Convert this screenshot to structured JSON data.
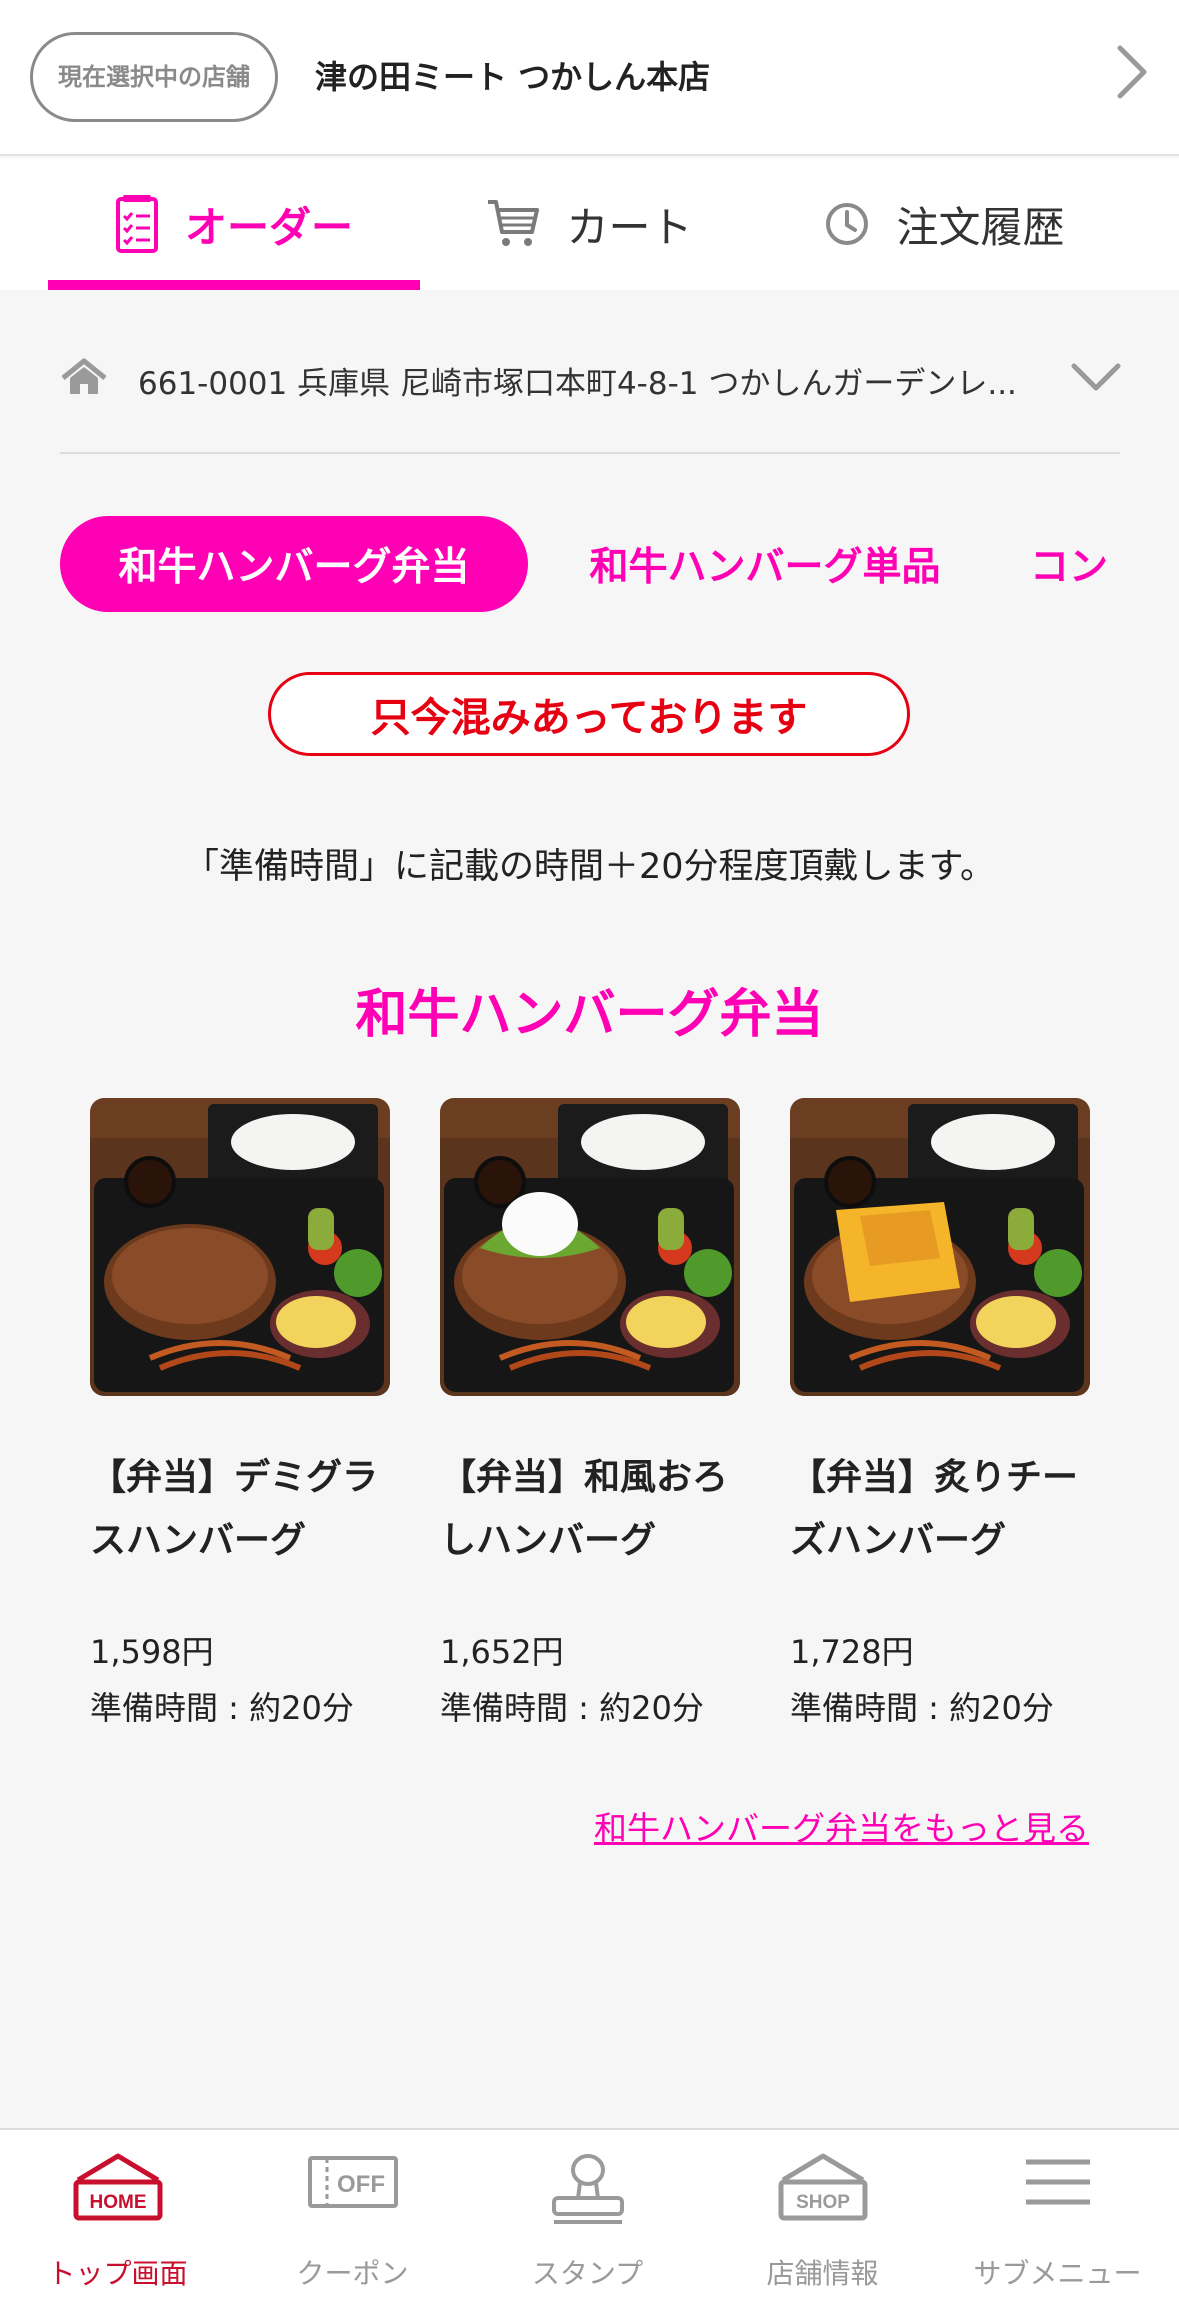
{
  "store": {
    "badge_label": "現在選択中の店舗",
    "name": "津の田ミート つかしん本店"
  },
  "tabs": {
    "order": "オーダー",
    "cart": "カート",
    "history": "注文履歴"
  },
  "address": "661-0001 兵庫県 尼崎市塚口本町4-8-1 つかしんガーデンレ...",
  "categories": [
    "和牛ハンバーグ弁当",
    "和牛ハンバーグ単品",
    "コン"
  ],
  "busy_notice": "只今混みあっております",
  "notice": "「準備時間」に記載の時間＋20分程度頂戴します。",
  "section_title": "和牛ハンバーグ弁当",
  "products": [
    {
      "name": "【弁当】デミグラスハンバーグ",
      "price": "1,598円",
      "prep": "準備時間 : 約20分",
      "topping": "none"
    },
    {
      "name": "【弁当】和風おろしハンバーグ",
      "price": "1,652円",
      "prep": "準備時間 : 約20分",
      "topping": "oroshi"
    },
    {
      "name": "【弁当】炙りチーズハンバーグ",
      "price": "1,728円",
      "prep": "準備時間 : 約20分",
      "topping": "cheese"
    }
  ],
  "more_link": "和牛ハンバーグ弁当をもっと見る",
  "bottom_nav": [
    {
      "label": "トップ画面",
      "icon": "home-icon",
      "icon_text": "HOME",
      "active": true
    },
    {
      "label": "クーポン",
      "icon": "coupon-icon",
      "icon_text": "OFF",
      "active": false
    },
    {
      "label": "スタンプ",
      "icon": "stamp-icon",
      "icon_text": "",
      "active": false
    },
    {
      "label": "店舗情報",
      "icon": "shop-icon",
      "icon_text": "SHOP",
      "active": false
    },
    {
      "label": "サブメニュー",
      "icon": "menu-icon",
      "icon_text": "",
      "active": false
    }
  ],
  "colors": {
    "accent": "#ff00b4",
    "alert": "#e60012",
    "nav_active": "#c8102e"
  }
}
